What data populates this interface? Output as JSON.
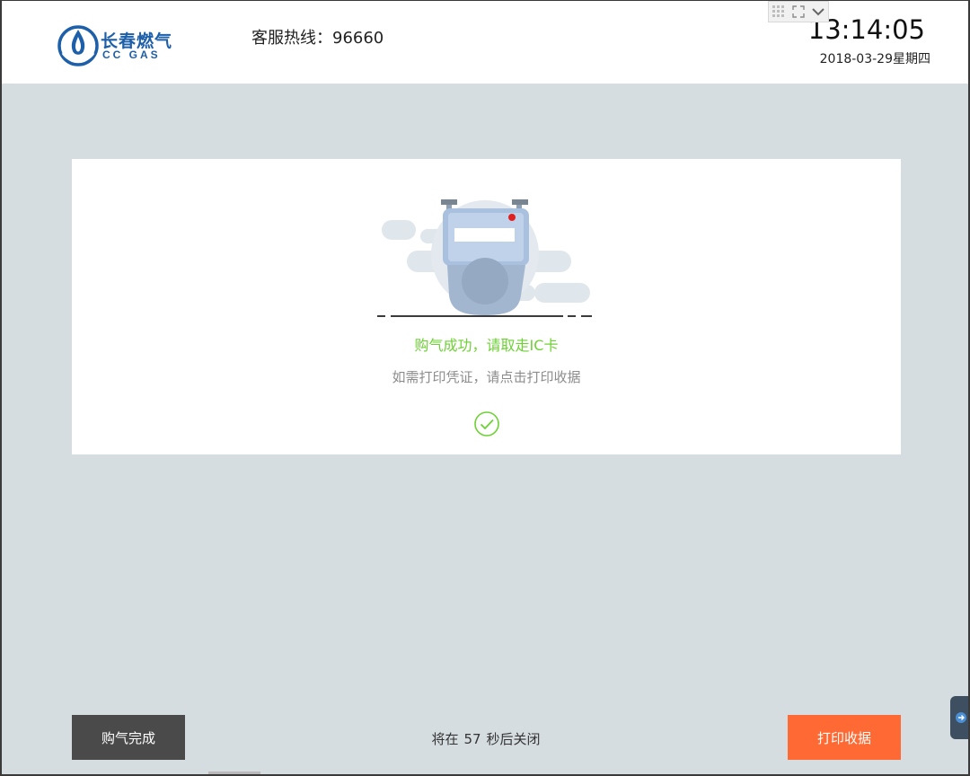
{
  "header": {
    "logo": {
      "cn": "长春燃气",
      "en": "CC GAS"
    },
    "hotline": "客服热线：96660",
    "time": "13:14:05",
    "date": "2018-03-29星期四"
  },
  "card": {
    "success_message": "购气成功，请取走IC卡",
    "hint_message": "如需打印凭证，请点击打印收据"
  },
  "footer": {
    "done_button": "购气完成",
    "countdown_prefix": "将在",
    "countdown_seconds": "57",
    "countdown_suffix": "秒后关闭",
    "print_button": "打印收据"
  },
  "icons": {
    "window_controls": [
      "grid-icon",
      "expand-icon",
      "chevron-down-icon"
    ],
    "illustration": "gas-meter-icon",
    "status": "check-circle-icon",
    "side": "remote-tab-icon"
  },
  "colors": {
    "background": "#d6dde1",
    "success": "#6ed135",
    "hint": "#8c8c8c",
    "done_button": "#4a4a4a",
    "print_button": "#ff6933",
    "brand": "#1d5fa8"
  }
}
